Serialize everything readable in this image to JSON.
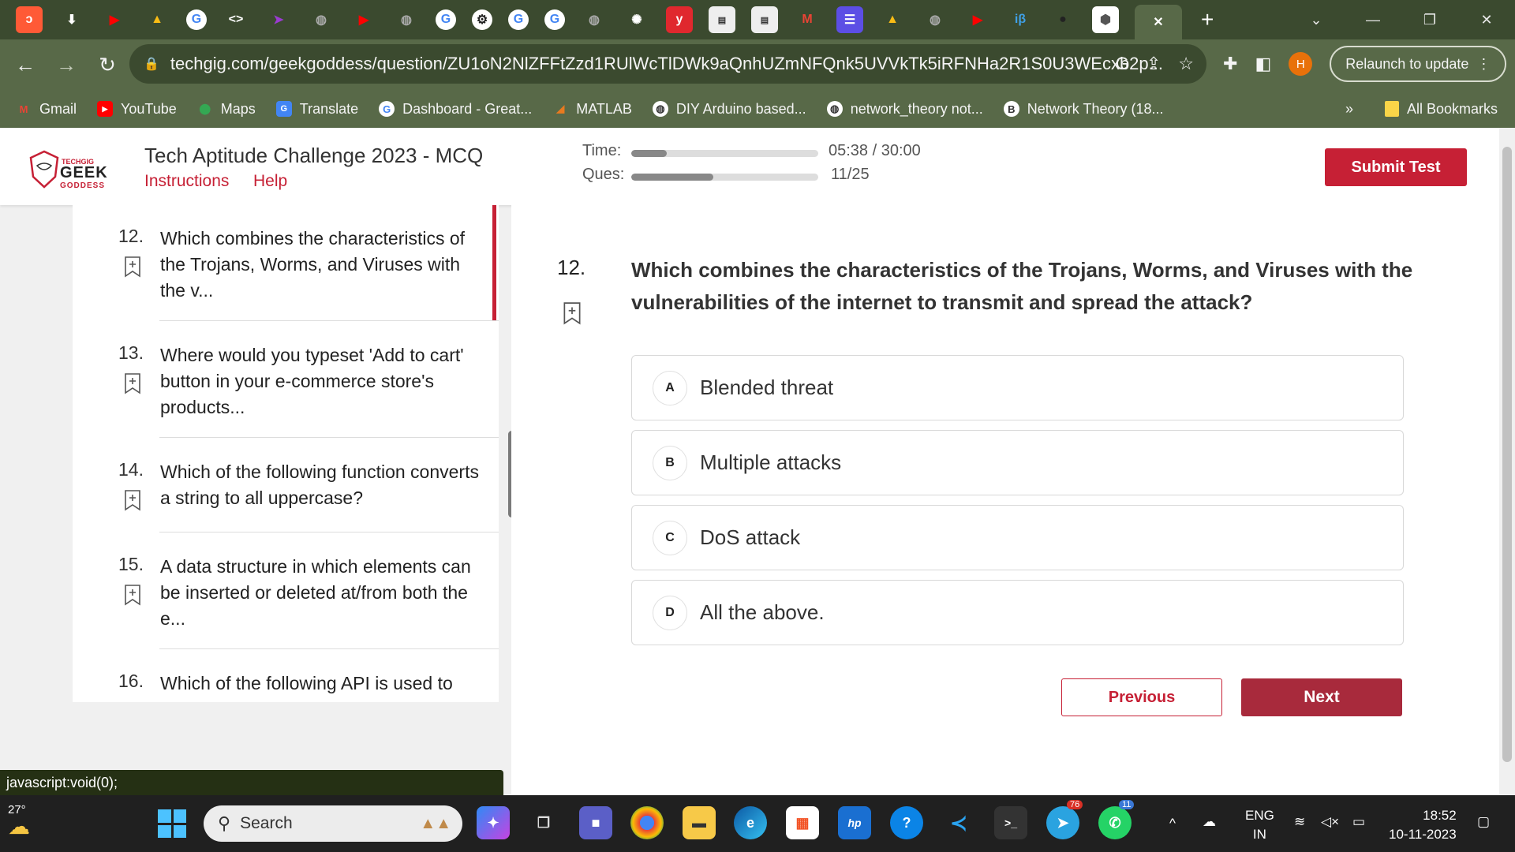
{
  "browser": {
    "url": "techgig.com/geekgoddess/question/ZU1oN2NlZFFtZzd1RUlWcTlDWk9aQnhUZmNFQnk5UVVkTk5iRFNHa2R1S0U3WEcxb2p...",
    "relaunch_label": "Relaunch to update",
    "profile_initial": "H",
    "bookmarks": [
      "Gmail",
      "YouTube",
      "Maps",
      "Translate",
      "Dashboard - Great...",
      "MATLAB",
      "DIY Arduino based...",
      "network_theory not...",
      "Network Theory (18..."
    ],
    "all_bookmarks": "All Bookmarks",
    "overflow": "»"
  },
  "header": {
    "logo": {
      "top": "TECHGIG",
      "main": "GEEK",
      "sub": "GODDESS"
    },
    "title": "Tech Aptitude Challenge 2023 - MCQ",
    "instructions_link": "Instructions",
    "help_link": "Help",
    "time_label": "Time:",
    "time_value": "05:38 / 30:00",
    "time_progress": 0.19,
    "ques_label": "Ques:",
    "ques_value": "11/25",
    "ques_progress": 0.44,
    "submit_label": "Submit Test"
  },
  "sidebar": {
    "questions": [
      {
        "num": "12.",
        "text": "Which combines the characteristics of the Trojans, Worms, and Viruses with the v..."
      },
      {
        "num": "13.",
        "text": "Where would you typeset 'Add to cart' button in your e-commerce store's products..."
      },
      {
        "num": "14.",
        "text": "Which of the following function converts a string to all uppercase?"
      },
      {
        "num": "15.",
        "text": "A data structure in which elements can be inserted or deleted at/from both the e..."
      },
      {
        "num": "16.",
        "text": "Which of the following API is used to"
      }
    ]
  },
  "question": {
    "number": "12.",
    "text": "Which combines the characteristics of the Trojans, Worms, and Viruses with the vulnerabilities of the internet to transmit and spread the attack?",
    "options": [
      {
        "letter": "A",
        "text": "Blended threat"
      },
      {
        "letter": "B",
        "text": "Multiple attacks"
      },
      {
        "letter": "C",
        "text": "DoS attack"
      },
      {
        "letter": "D",
        "text": "All the above."
      }
    ],
    "previous_label": "Previous",
    "next_label": "Next"
  },
  "status_bar": {
    "text": "javascript:void(0);"
  },
  "taskbar": {
    "weather_temp": "27°",
    "search_placeholder": "Search",
    "lang_top": "ENG",
    "lang_bottom": "IN",
    "time": "18:52",
    "date": "10-11-2023",
    "telegram_badge": "76",
    "whatsapp_badge": "11"
  },
  "colors": {
    "accent": "#c62035",
    "next": "#a82a3c",
    "chrome": "#586948",
    "tabstrip": "#3b4a2f"
  }
}
